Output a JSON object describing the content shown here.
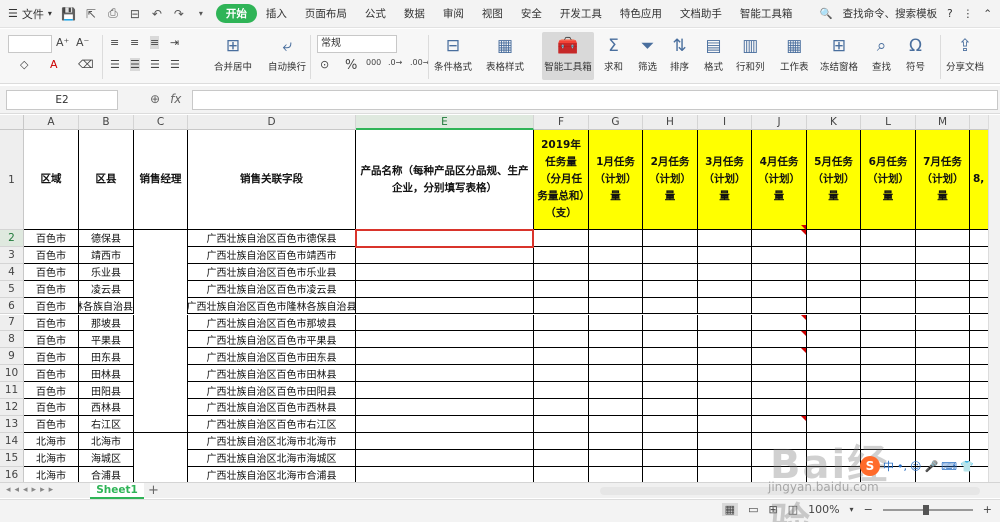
{
  "menubar": {
    "file_label": "文件",
    "tabs": [
      "开始",
      "插入",
      "页面布局",
      "公式",
      "数据",
      "审阅",
      "视图",
      "安全",
      "开发工具",
      "特色应用",
      "文档助手",
      "智能工具箱"
    ],
    "active_tab": "开始",
    "search_label": "查找命令、搜索模板",
    "help_label": "?"
  },
  "ribbon": {
    "number_format": "常规",
    "merge_center": "合并居中",
    "wrap_text": "自动换行",
    "conditional_format": "条件格式",
    "table_style": "表格样式",
    "smart_toolbox": "智能工具箱",
    "sum": "求和",
    "filter": "筛选",
    "sort": "排序",
    "format": "格式",
    "rows_cols": "行和列",
    "worksheet": "工作表",
    "freeze": "冻结窗格",
    "find": "查找",
    "symbol": "符号",
    "share": "分享文档",
    "accent_color": "#2fb457"
  },
  "formula": {
    "name_box": "E2",
    "fx": "fx",
    "content": ""
  },
  "grid": {
    "columns": [
      "A",
      "B",
      "C",
      "D",
      "E",
      "F",
      "G",
      "H",
      "I",
      "J",
      "K",
      "L",
      "M"
    ],
    "selected_column": "E",
    "selected_row": "2",
    "header_row_num": "1",
    "headers": {
      "region": "区域",
      "county": "区县",
      "manager": "销售经理",
      "field": "销售关联字段",
      "product": "产品名称（每种产品区分品规、生产企业，分别填写表格）",
      "annual": "2019年任务量（分月任务量总和）（支）",
      "m1": "1月任务（计划）量",
      "m2": "2月任务（计划）量",
      "m3": "3月任务（计划）量",
      "m4": "4月任务（计划）量",
      "m5": "5月任务（计划）量",
      "m6": "6月任务（计划）量",
      "m7": "7月任务（计划）量",
      "m8": "8,"
    },
    "rows": [
      {
        "num": "2",
        "region": "百色市",
        "county": "德保县",
        "field": "广西壮族自治区百色市德保县"
      },
      {
        "num": "3",
        "region": "百色市",
        "county": "靖西市",
        "field": "广西壮族自治区百色市靖西市"
      },
      {
        "num": "4",
        "region": "百色市",
        "county": "乐业县",
        "field": "广西壮族自治区百色市乐业县"
      },
      {
        "num": "5",
        "region": "百色市",
        "county": "凌云县",
        "field": "广西壮族自治区百色市凌云县"
      },
      {
        "num": "6",
        "region": "百色市",
        "county": "隆林各族自治县",
        "field": "广西壮族自治区百色市隆林各族自治县"
      },
      {
        "num": "7",
        "region": "百色市",
        "county": "那坡县",
        "field": "广西壮族自治区百色市那坡县"
      },
      {
        "num": "8",
        "region": "百色市",
        "county": "平果县",
        "field": "广西壮族自治区百色市平果县"
      },
      {
        "num": "9",
        "region": "百色市",
        "county": "田东县",
        "field": "广西壮族自治区百色市田东县"
      },
      {
        "num": "10",
        "region": "百色市",
        "county": "田林县",
        "field": "广西壮族自治区百色市田林县"
      },
      {
        "num": "11",
        "region": "百色市",
        "county": "田阳县",
        "field": "广西壮族自治区百色市田阳县"
      },
      {
        "num": "12",
        "region": "百色市",
        "county": "西林县",
        "field": "广西壮族自治区百色市西林县"
      },
      {
        "num": "13",
        "region": "百色市",
        "county": "右江区",
        "field": "广西壮族自治区百色市右江区"
      },
      {
        "num": "14",
        "region": "北海市",
        "county": "北海市",
        "field": "广西壮族自治区北海市北海市"
      },
      {
        "num": "15",
        "region": "北海市",
        "county": "海城区",
        "field": "广西壮族自治区北海市海城区"
      },
      {
        "num": "16",
        "region": "北海市",
        "county": "合浦县",
        "field": "广西壮族自治区北海市合浦县"
      }
    ]
  },
  "sheets": {
    "active": "Sheet1",
    "add": "+"
  },
  "status": {
    "zoom": "100%"
  },
  "watermark": {
    "text": "Bai经验",
    "url": "jingyan.baidu.com"
  }
}
